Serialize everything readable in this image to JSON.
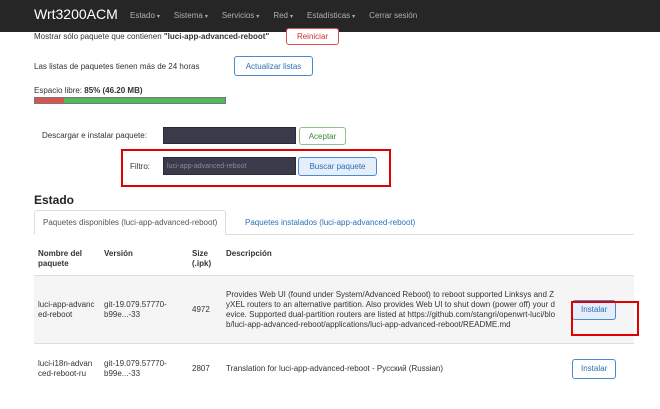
{
  "navbar": {
    "brand": "Wrt3200ACM",
    "items": [
      "Estado",
      "Sistema",
      "Servicios",
      "Red",
      "Estadísticas",
      "Cerrar sesión"
    ]
  },
  "filter_notice": {
    "prefix": "Mostrar sólo paquete que contienen ",
    "term": "\"luci-app-advanced-reboot\"",
    "reset_label": "Reiniciar"
  },
  "lists": {
    "text": "Las listas de paquetes tienen más de 24 horas",
    "update_label": "Actualizar listas"
  },
  "disk": {
    "label": "Espacio libre:",
    "value": "85% (46.20 MB)",
    "used_fraction": 0.15
  },
  "install": {
    "label": "Descargar e instalar paquete:",
    "value": "",
    "accept_label": "Aceptar"
  },
  "filter": {
    "label": "Filtro:",
    "placeholder": "luci-app-advanced-reboot",
    "search_label": "Buscar paquete"
  },
  "section_title": "Estado",
  "tabs": [
    "Paquetes disponibles (luci-app-advanced-reboot)",
    "Paquetes instalados (luci-app-advanced-reboot)"
  ],
  "table": {
    "headers": [
      "Nombre del paquete",
      "Versión",
      "Size (.ipk)",
      "Descripción"
    ],
    "rows": [
      {
        "name": "luci-app-advanced-reboot",
        "version": "git-19.079.57770-b99e...-33",
        "size": "4972",
        "description": "Provides Web UI (found under System/Advanced Reboot) to reboot supported Linksys and ZyXEL routers to an alternative partition. Also provides Web UI to shut down (power off) your device. Supported dual-partition routers are listed at https://github.com/stangri/openwrt-luci/blob/luci-app-advanced-reboot/applications/luci-app-advanced-reboot/README.md",
        "action": "Instalar"
      },
      {
        "name": "luci-i18n-advanced-reboot-ru",
        "version": "git-19.079.57770-b99e...-33",
        "size": "2807",
        "description": "Translation for luci-app-advanced-reboot - Русский (Russian)",
        "action": "Instalar"
      }
    ]
  }
}
